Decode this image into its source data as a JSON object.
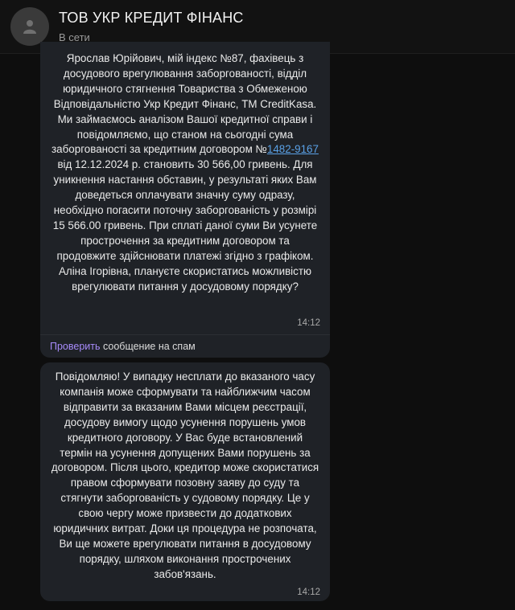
{
  "header": {
    "title": "ТОВ УКР КРЕДИТ ФІНАНС",
    "status": "В сети",
    "avatar_icon": "user-icon"
  },
  "messages": [
    {
      "text_before_link": "Ярослав Юрійович, мій індекс №87, фахівець з досудового врегулювання заборгованості, відділ юридичного стягнення Товариства з Обмеженою Відповідальністю Укр Кредит Фінанс, ТМ CreditKasa. Ми займаємось аналізом Вашої кредитної справи і повідомляємо, що станом на сьогодні сума заборгованості за кредитним договором №",
      "link_text": "1482-9167",
      "text_after_link": " від 12.12.2024 р. становить 30 566,00 гривень. Для уникнення настання обставин, у результаті яких Вам доведеться оплачувати значну суму одразу, необхідно погасити поточну заборгованість у розмірі 15 566.00 гривень. При сплаті даної суми Ви усунете прострочення за кредитним договором та продовжите здійснювати платежі згідно з графіком. Аліна Ігорівна, плануєте скористатись можливістю врегулювати питання у досудовому порядку?",
      "time": "14:12"
    },
    {
      "text": "Повідомляю! У випадку несплати до вказаного часу компанія може сформувати та найближчим часом відправити за вказаним Вами місцем реєстрації, досудову вимогу щодо усунення порушень умов кредитного договору. У Вас буде встановлений термін на усунення допущених Вами порушень за договором. Після цього, кредитор може скористатися правом сформувати позовну заяву до суду та стягнути заборгованість у судовому порядку. Це у свою чергу може призвести до додаткових юридичних витрат. Доки ця процедура не розпочата, Ви ще можете врегулювати питання в досудовому порядку, шляхом виконання прострочених забов'язань.",
      "time": "14:12"
    }
  ],
  "spam": {
    "link_label": "Проверить",
    "rest": " сообщение на спам"
  }
}
